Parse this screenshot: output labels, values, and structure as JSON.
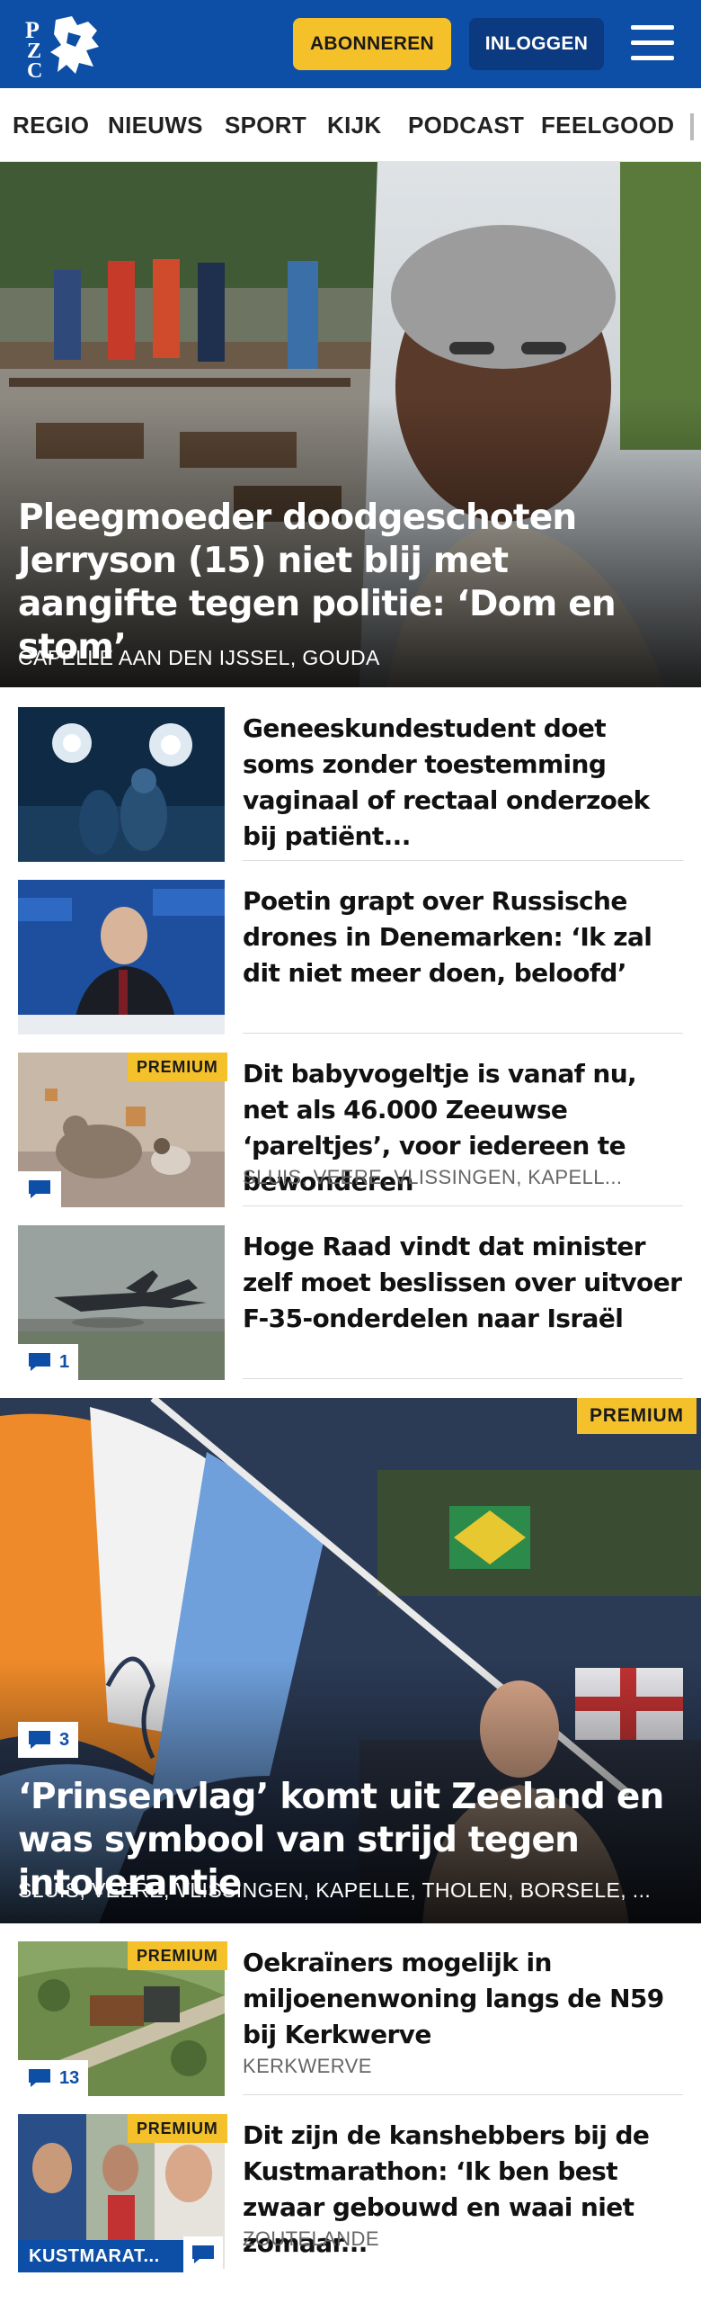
{
  "header": {
    "logo_text": "PZC",
    "subscribe_label": "ABONNEREN",
    "login_label": "INLOGGEN",
    "menu_icon": "hamburger-menu-icon",
    "brand_color": "#0d4ea6",
    "accent_color": "#f5c12b"
  },
  "nav": {
    "items": [
      "REGIO",
      "NIEUWS",
      "SPORT",
      "KIJK",
      "PODCAST",
      "FEELGOOD"
    ]
  },
  "hero": {
    "title": "Pleegmoeder doodgeschoten Jerryson (15) niet blij met aangifte tegen politie: ‘Dom en stom’",
    "location": "CAPELLE AAN DEN IJSSEL, GOUDA"
  },
  "articles": [
    {
      "title": "Geneeskundestudent doet soms zonder toestemming vaginaal of rectaal onderzoek bij patiënt...",
      "location": "",
      "premium": "",
      "comments": ""
    },
    {
      "title": "Poetin grapt over Russische drones in Denemarken: ‘Ik zal dit niet meer doen, beloofd’",
      "location": "",
      "premium": "",
      "comments": ""
    },
    {
      "title": "Dit babyvogeltje is vanaf nu, net als 46.000 Zeeuwse ‘pareltjes’, voor iedereen te bewonderen",
      "location": "SLUIS, VEERE, VLISSINGEN, KAPELL...",
      "premium": "PREMIUM",
      "comments": ""
    },
    {
      "title": "Hoge Raad vindt dat minister zelf moet beslissen over uitvoer F-35-onderdelen naar Israël",
      "location": "",
      "premium": "",
      "comments": "1"
    }
  ],
  "feature": {
    "title": "‘Prinsenvlag’ komt uit Zeeland en was symbool van strijd tegen intolerantie",
    "location": "SLUIS, VEERE, VLISSINGEN, KAPELLE, THOLEN, BORSELE, ...",
    "premium": "PREMIUM",
    "comments": "3"
  },
  "articles2": [
    {
      "title": "Oekraïners mogelijk in miljoenenwoning langs de N59 bij Kerkwerve",
      "location": "KERKWERVE",
      "premium": "PREMIUM",
      "comments": "13"
    },
    {
      "title": "Dit zijn de kanshebbers bij de Kustmarathon: ‘Ik ben best zwaar gebouwd en waai niet zomaar...",
      "location": "ZOUTELANDE",
      "premium": "PREMIUM",
      "comments": "",
      "label": "KUSTMARAT..."
    }
  ]
}
